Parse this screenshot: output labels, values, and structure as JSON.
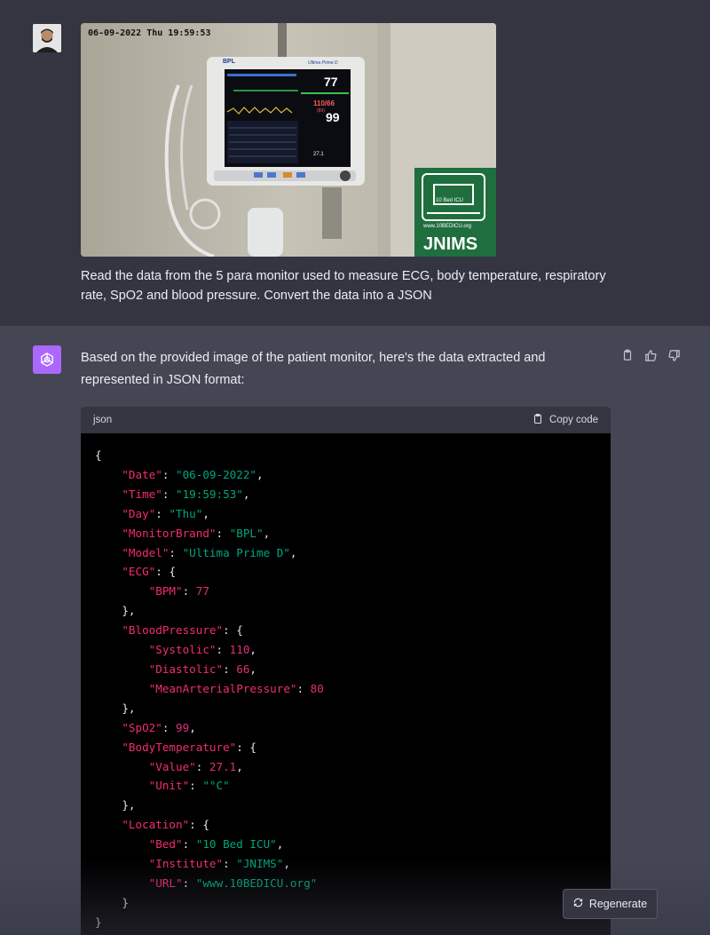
{
  "user_message": {
    "text": "Read the data from the 5 para monitor used to measure ECG, body temperature, respiratory rate, SpO2 and blood pressure. Convert the data into a JSON",
    "photo": {
      "timestamp": "06-09-2022 Thu 19:59:53",
      "monitor_brand": "BPL",
      "monitor_model": "Ultima Prime D",
      "hr": "77",
      "bp": "110/66",
      "map": "(80)",
      "spo2": "99",
      "temp": "27.1",
      "sign_line1": "10 Bed ICU",
      "sign_url": "www.10BEDICU.org",
      "sign_name": "JNIMS"
    }
  },
  "assistant_message": {
    "intro": "Based on the provided image of the patient monitor, here's the data extracted and represented in JSON format:",
    "code": {
      "language": "json",
      "copy_label": "Copy code",
      "lines": [
        {
          "indent": 0,
          "text": "{"
        },
        {
          "indent": 1,
          "key": "Date",
          "str": "06-09-2022"
        },
        {
          "indent": 1,
          "key": "Time",
          "str": "19:59:53"
        },
        {
          "indent": 1,
          "key": "Day",
          "str": "Thu"
        },
        {
          "indent": 1,
          "key": "MonitorBrand",
          "str": "BPL"
        },
        {
          "indent": 1,
          "key": "Model",
          "str": "Ultima Prime D"
        },
        {
          "indent": 1,
          "key": "ECG",
          "open": "{"
        },
        {
          "indent": 2,
          "key": "BPM",
          "num": "77",
          "last": true
        },
        {
          "indent": 1,
          "text": "},"
        },
        {
          "indent": 1,
          "key": "BloodPressure",
          "open": "{"
        },
        {
          "indent": 2,
          "key": "Systolic",
          "num": "110"
        },
        {
          "indent": 2,
          "key": "Diastolic",
          "num": "66"
        },
        {
          "indent": 2,
          "key": "MeanArterialPressure",
          "num": "80",
          "last": true
        },
        {
          "indent": 1,
          "text": "},"
        },
        {
          "indent": 1,
          "key": "SpO2",
          "num": "99"
        },
        {
          "indent": 1,
          "key": "BodyTemperature",
          "open": "{"
        },
        {
          "indent": 2,
          "key": "Value",
          "num": "27.1"
        },
        {
          "indent": 2,
          "key": "Unit",
          "str": "°C",
          "last": true
        },
        {
          "indent": 1,
          "text": "},"
        },
        {
          "indent": 1,
          "key": "Location",
          "open": "{"
        },
        {
          "indent": 2,
          "key": "Bed",
          "str": "10 Bed ICU"
        },
        {
          "indent": 2,
          "key": "Institute",
          "str": "JNIMS"
        },
        {
          "indent": 2,
          "key": "URL",
          "str": "www.10BEDICU.org",
          "last": true
        },
        {
          "indent": 1,
          "text": "}"
        },
        {
          "indent": 0,
          "text": "}"
        }
      ]
    },
    "regenerate_label": "Regenerate",
    "action_icons": [
      "clipboard-icon",
      "thumbs-up-icon",
      "thumbs-down-icon"
    ]
  },
  "colors": {
    "user_bg": "#343541",
    "assistant_bg": "#444654",
    "bot_avatar": "#ab68ff",
    "json_key": "#f22c74",
    "json_string": "#00a67d",
    "json_number": "#df3079"
  }
}
